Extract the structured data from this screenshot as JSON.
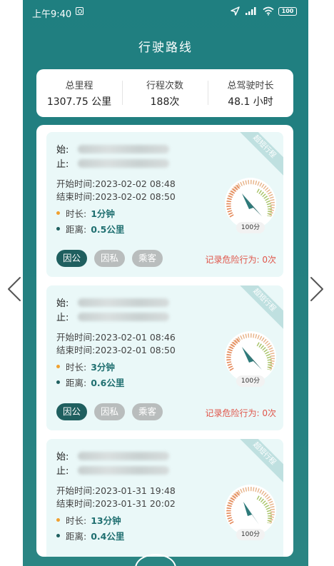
{
  "status_bar": {
    "time": "上午9:40",
    "signal_label": "HD",
    "battery": "100"
  },
  "header": {
    "title": "行驶路线"
  },
  "summary": [
    {
      "label": "总里程",
      "value": "1307.75 公里"
    },
    {
      "label": "行程次数",
      "value": "188次"
    },
    {
      "label": "总驾驶时长",
      "value": "48.1 小时"
    }
  ],
  "trips": [
    {
      "ribbon": "超短行程",
      "start_label": "始:",
      "end_label": "止:",
      "start_time": "开始时间:2023-02-02 08:48",
      "end_time": "结束时间:2023-02-02 08:50",
      "duration_label": "时长:",
      "duration": "1分钟",
      "distance_label": "距离:",
      "distance": "0.5公里",
      "tags": [
        "因公",
        "因私",
        "乘客"
      ],
      "danger": "记录危险行为: 0次",
      "score": "100分"
    },
    {
      "ribbon": "超短行程",
      "start_label": "始:",
      "end_label": "止:",
      "start_time": "开始时间:2023-02-01 08:46",
      "end_time": "结束时间:2023-02-01 08:50",
      "duration_label": "时长:",
      "duration": "3分钟",
      "distance_label": "距离:",
      "distance": "0.6公里",
      "tags": [
        "因公",
        "因私",
        "乘客"
      ],
      "danger": "记录危险行为: 0次",
      "score": "100分"
    },
    {
      "ribbon": "超短行程",
      "start_label": "始:",
      "end_label": "止:",
      "start_time": "开始时间:2023-01-31 19:48",
      "end_time": "结束时间:2023-01-31 20:02",
      "duration_label": "时长:",
      "duration": "13分钟",
      "distance_label": "距离:",
      "distance": "0.4公里",
      "score": "100分"
    }
  ],
  "colors": {
    "brand": "#1f7f80",
    "tag_active": "#1f5f5f",
    "danger": "#e0554a"
  }
}
